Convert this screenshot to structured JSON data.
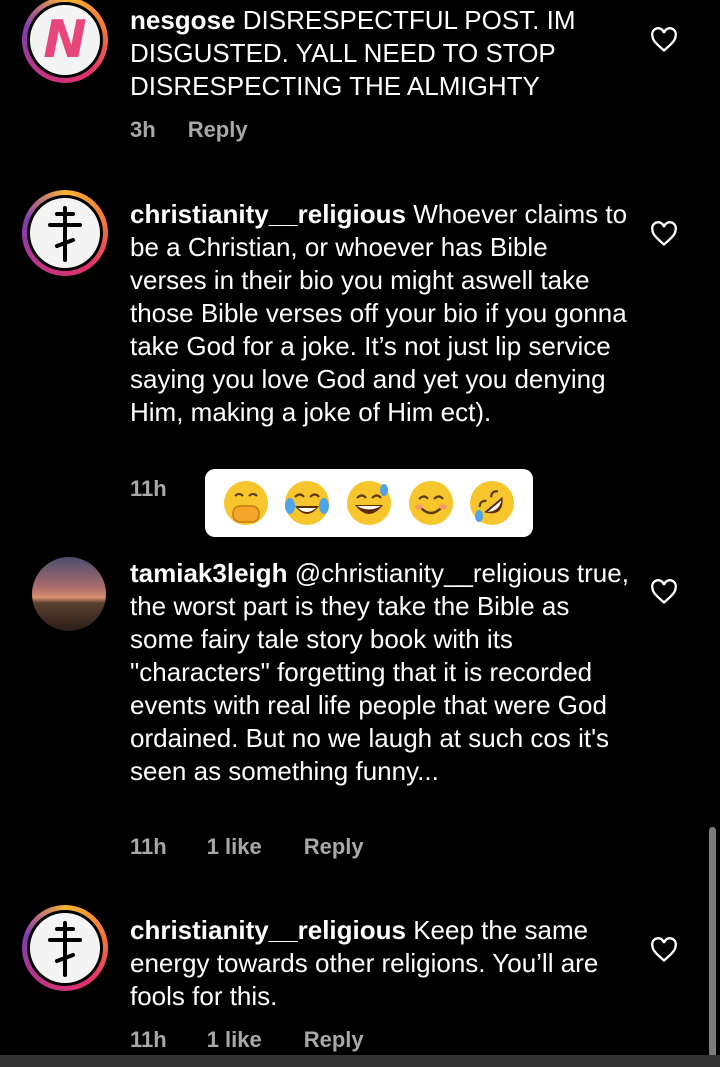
{
  "comments": [
    {
      "username": "nesgose",
      "text": "DISRESPECTFUL POST. IM DISGUSTED. YALL NEED TO STOP DISRESPECTING THE ALMIGHTY",
      "time": "3h",
      "likes": "",
      "reply": "Reply",
      "avatar": "N",
      "like_icon": "heart-outline-icon"
    },
    {
      "username": "christianity__religious",
      "text": "Whoever claims to be a Christian, or whoever has Bible verses in their bio you might aswell take those Bible verses off your bio if you gonna take God for a joke. It’s not just lip service saying you love God and yet you denying Him, making a joke of Him ect).",
      "time": "11h",
      "likes": "",
      "reply": "",
      "avatar": "orthodox-cross-icon",
      "like_icon": "heart-outline-icon"
    },
    {
      "username": "tamiak3leigh",
      "text": "@christianity__religious true, the worst part is they take the Bible as some fairy tale story book with its \"characters\" forgetting that it is recorded events with real life people that were God ordained. But no we laugh at such cos it's seen as something funny...",
      "time": "11h",
      "likes": "1 like",
      "reply": "Reply",
      "avatar": "sunset-photo",
      "like_icon": "heart-outline-icon"
    },
    {
      "username": "christianity__religious",
      "text": "Keep the same energy towards other religions. You’ll are fools for this.",
      "time": "11h",
      "likes": "1 like",
      "reply": "Reply",
      "avatar": "orthodox-cross-icon",
      "like_icon": "heart-outline-icon"
    }
  ],
  "emoji_sticker": [
    "hand-over-mouth-emoji",
    "tears-of-joy-emoji",
    "grinning-sweat-emoji",
    "smiling-emoji",
    "rolling-laughing-emoji"
  ],
  "colors": {
    "background": "#000000",
    "meta_text": "#a8a8a8",
    "ring_start": "#f9b233",
    "ring_end": "#c13584"
  }
}
